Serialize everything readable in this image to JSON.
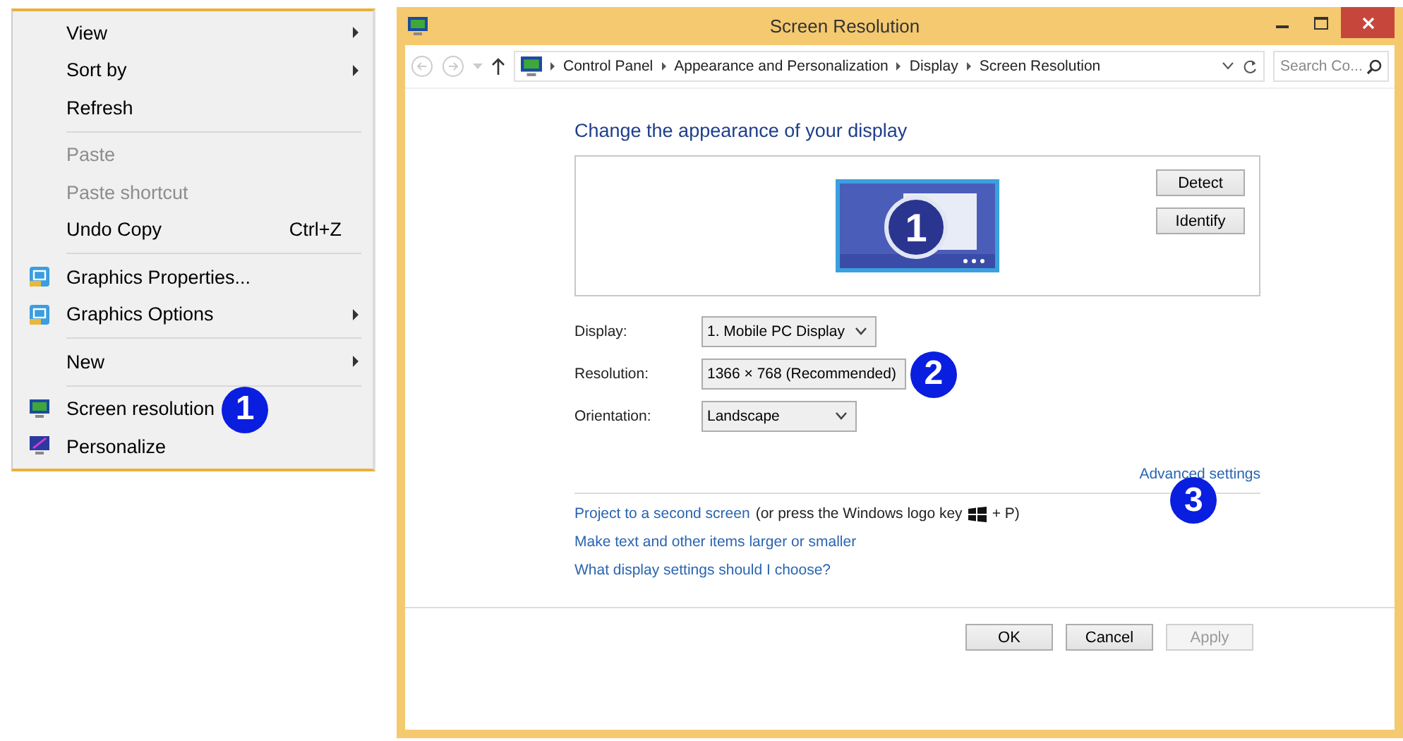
{
  "context_menu": {
    "items": [
      {
        "kind": "item",
        "label": "View",
        "disabled": false,
        "submenu": true
      },
      {
        "kind": "item",
        "label": "Sort by",
        "disabled": false,
        "submenu": true
      },
      {
        "kind": "item",
        "label": "Refresh",
        "disabled": false,
        "submenu": false
      },
      {
        "kind": "separator"
      },
      {
        "kind": "item",
        "label": "Paste",
        "disabled": true,
        "submenu": false
      },
      {
        "kind": "item",
        "label": "Paste shortcut",
        "disabled": true,
        "submenu": false
      },
      {
        "kind": "item",
        "label": "Undo Copy",
        "disabled": false,
        "submenu": false,
        "shortcut": "Ctrl+Z"
      },
      {
        "kind": "separator"
      },
      {
        "kind": "graphics_item",
        "label": "Graphics Properties...",
        "disabled": false,
        "submenu": false
      },
      {
        "kind": "graphics_item",
        "label": "Graphics Options",
        "disabled": false,
        "submenu": true
      },
      {
        "kind": "separator"
      },
      {
        "kind": "item",
        "label": "New",
        "disabled": false,
        "submenu": true
      },
      {
        "kind": "separator"
      },
      {
        "kind": "display_item",
        "label": "Screen resolution",
        "disabled": false,
        "submenu": false,
        "callout": "1"
      },
      {
        "kind": "personalize_item",
        "label": "Personalize",
        "disabled": false,
        "submenu": false
      }
    ]
  },
  "window": {
    "title": "Screen Resolution",
    "address_bar": {
      "breadcrumbs": [
        "Control Panel",
        "Appearance and Personalization",
        "Display",
        "Screen Resolution"
      ]
    },
    "search": {
      "placeholder": "Search Co..."
    },
    "heading": "Change the appearance of your display",
    "preview": {
      "monitor_number": "1",
      "buttons": [
        "Detect",
        "Identify"
      ]
    },
    "form": [
      {
        "label": "Display:",
        "value": "1. Mobile PC Display"
      },
      {
        "label": "Resolution:",
        "value": "1366 × 768 (Recommended)",
        "callout": "2"
      },
      {
        "label": "Orientation:",
        "value": "Landscape"
      }
    ],
    "advanced_link": {
      "label": "Advanced settings",
      "callout": "3"
    },
    "links": [
      {
        "label": "Project to a second screen",
        "note_before_key": "(or press the Windows logo key",
        "note_after_key": "+ P)"
      },
      {
        "label": "Make text and other items larger or smaller"
      },
      {
        "label": "What display settings should I choose?"
      }
    ],
    "buttons": [
      {
        "label": "OK",
        "disabled": false
      },
      {
        "label": "Cancel",
        "disabled": false
      },
      {
        "label": "Apply",
        "disabled": true
      }
    ]
  }
}
